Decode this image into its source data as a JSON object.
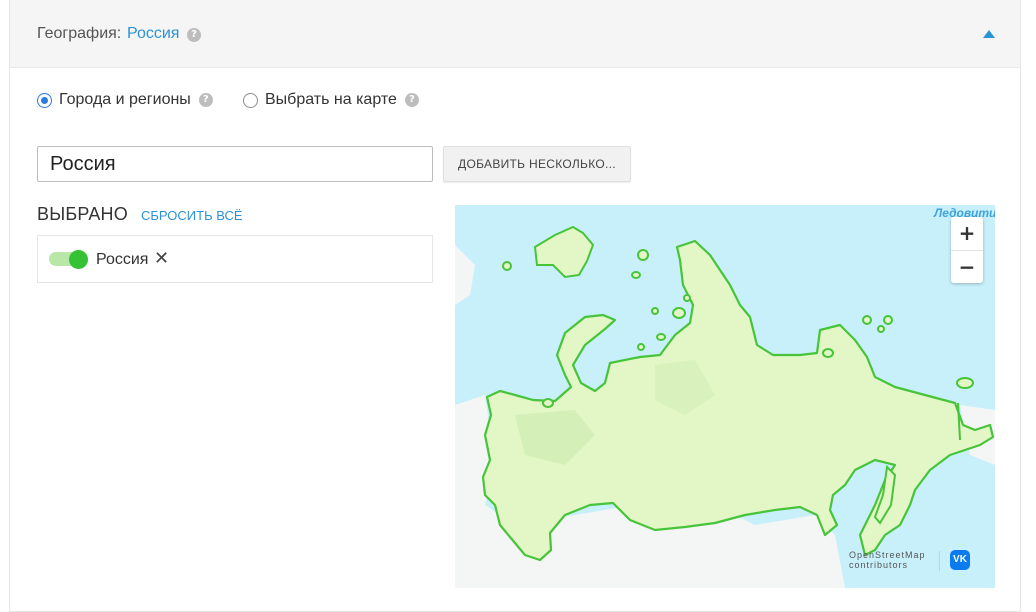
{
  "header": {
    "label": "География:",
    "value": "Россия",
    "help_glyph": "?",
    "collapse_icon": "triangle-up-icon"
  },
  "mode": {
    "options": [
      {
        "label": "Города и регионы",
        "selected": true
      },
      {
        "label": "Выбрать на карте",
        "selected": false
      }
    ],
    "help_glyph": "?"
  },
  "search": {
    "value": "Россия",
    "add_button_label": "ДОБАВИТЬ НЕСКОЛЬКО..."
  },
  "selected": {
    "title": "ВЫБРАНО",
    "reset_label": "СБРОСИТЬ ВСЁ",
    "items": [
      {
        "label": "Россия",
        "enabled": true,
        "remove_glyph": "✕"
      }
    ]
  },
  "map": {
    "sea_label": "Ледовити",
    "zoom_in": "+",
    "zoom_out": "−",
    "attribution_line1": "OpenStreetMap",
    "attribution_line2": "contributors",
    "logo_text": "VK"
  },
  "colors": {
    "accent": "#2b93d6",
    "radio": "#2b7be0",
    "toggle_on": "#35c235",
    "water": "#c8f0fb",
    "land_fill": "#e2f6c6",
    "region_border": "#47c43a"
  }
}
